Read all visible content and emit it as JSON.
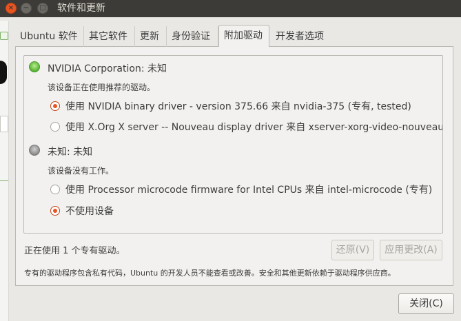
{
  "window": {
    "title": "软件和更新"
  },
  "titlebar_buttons": {
    "close": "×",
    "minimize": "−",
    "maximize": "□"
  },
  "tabs": [
    {
      "label": "Ubuntu 软件",
      "active": false
    },
    {
      "label": "其它软件",
      "active": false
    },
    {
      "label": "更新",
      "active": false
    },
    {
      "label": "身份验证",
      "active": false
    },
    {
      "label": "附加驱动",
      "active": true
    },
    {
      "label": "开发者选项",
      "active": false
    }
  ],
  "devices": [
    {
      "name": "NVIDIA Corporation: 未知",
      "status_led": "green",
      "status_text": "该设备正在使用推荐的驱动。",
      "options": [
        {
          "label": "使用 NVIDIA binary driver - version 375.66 来自 nvidia-375 (专有, tested)",
          "selected": true
        },
        {
          "label": "使用 X.Org X server -- Nouveau display driver 来自 xserver-xorg-video-nouveau (开",
          "selected": false
        }
      ]
    },
    {
      "name": "未知: 未知",
      "status_led": "gray",
      "status_text": "该设备没有工作。",
      "options": [
        {
          "label": "使用 Processor microcode firmware for Intel CPUs 来自 intel-microcode (专有)",
          "selected": false
        },
        {
          "label": "不使用设备",
          "selected": true
        }
      ]
    }
  ],
  "status_line": "正在使用 1 个专有驱动。",
  "buttons": {
    "revert": "还原(V)",
    "apply": "应用更改(A)",
    "close": "关闭(C)"
  },
  "footer_note": "专有的驱动程序包含私有代码，Ubuntu 的开发人员不能查看或改善。安全和其他更新依赖于驱动程序供应商。",
  "colors": {
    "accent": "#e95420",
    "titlebar": "#3c3b37",
    "window_bg": "#f2f1ef"
  }
}
